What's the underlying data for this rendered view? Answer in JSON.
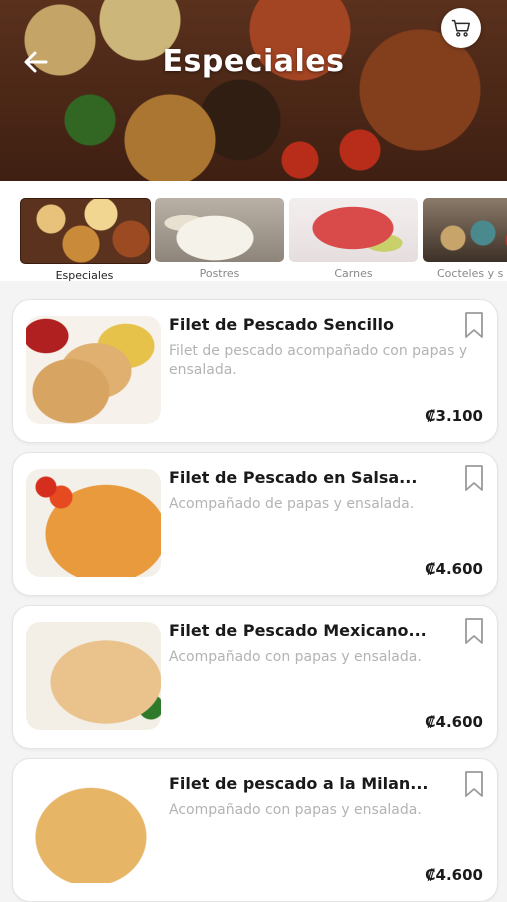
{
  "header": {
    "title": "Especiales",
    "back_icon": "arrow-left-icon",
    "cart_icon": "shopping-cart-icon"
  },
  "categories": [
    {
      "label": "Especiales",
      "active": true
    },
    {
      "label": "Postres",
      "active": false
    },
    {
      "label": "Carnes",
      "active": false
    },
    {
      "label": "Cocteles y s",
      "active": false
    }
  ],
  "products": [
    {
      "name": "Filet de Pescado Sencillo",
      "description": "Filet de pescado acompañado con papas y ensalada.",
      "price": "₡3.100"
    },
    {
      "name": "Filet de Pescado en Salsa...",
      "description": "Acompañado de papas y ensalada.",
      "price": "₡4.600"
    },
    {
      "name": "Filet de Pescado Mexicano...",
      "description": "Acompañado con papas y ensalada.",
      "price": "₡4.600"
    },
    {
      "name": "Filet de pescado a la Milan...",
      "description": "Acompañado con papas y ensalada.",
      "price": "₡4.600"
    }
  ]
}
